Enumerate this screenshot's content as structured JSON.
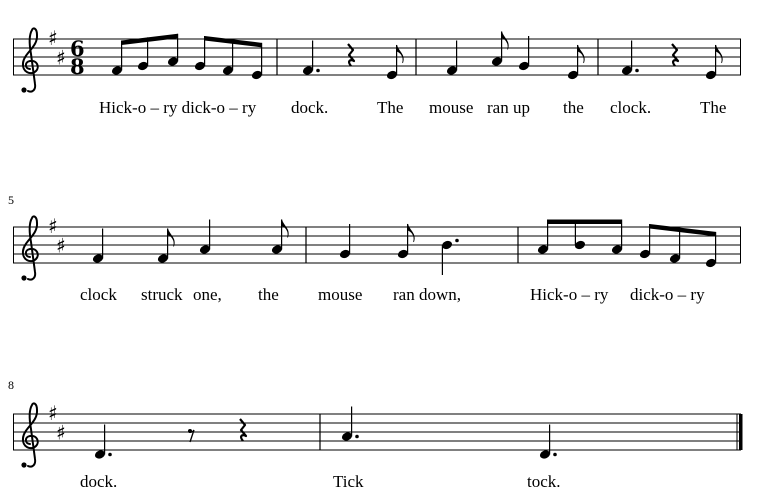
{
  "score": {
    "key_signature": "D major",
    "clef": "treble",
    "time_signature": {
      "top": "6",
      "bottom": "8"
    },
    "systems": [
      {
        "measure_number": "",
        "measures": [
          {
            "notes": [
              {
                "pitch": "F4",
                "duration": "8"
              },
              {
                "pitch": "G4",
                "duration": "8"
              },
              {
                "pitch": "A4",
                "duration": "8"
              },
              {
                "pitch": "G4",
                "duration": "8"
              },
              {
                "pitch": "F4",
                "duration": "8"
              },
              {
                "pitch": "E4",
                "duration": "8"
              }
            ]
          },
          {
            "notes": [
              {
                "pitch": "F4",
                "duration": "4."
              },
              {
                "pitch": "rest",
                "duration": "4"
              },
              {
                "pitch": "E4",
                "duration": "8"
              }
            ]
          },
          {
            "notes": [
              {
                "pitch": "F4",
                "duration": "4"
              },
              {
                "pitch": "A4",
                "duration": "8"
              },
              {
                "pitch": "G4",
                "duration": "4"
              },
              {
                "pitch": "E4",
                "duration": "8"
              }
            ]
          },
          {
            "notes": [
              {
                "pitch": "F4",
                "duration": "4."
              },
              {
                "pitch": "rest",
                "duration": "4"
              },
              {
                "pitch": "E4",
                "duration": "8"
              }
            ]
          }
        ],
        "lyrics": [
          "Hick-o – ry dick-o – ry",
          "dock.",
          "The",
          "mouse",
          "ran up",
          "the",
          "clock.",
          "The"
        ]
      },
      {
        "measure_number": "5",
        "measures": [
          {
            "notes": [
              {
                "pitch": "F4",
                "duration": "4"
              },
              {
                "pitch": "F4",
                "duration": "8"
              },
              {
                "pitch": "A4",
                "duration": "4"
              },
              {
                "pitch": "A4",
                "duration": "8"
              }
            ]
          },
          {
            "notes": [
              {
                "pitch": "G4",
                "duration": "4"
              },
              {
                "pitch": "G4",
                "duration": "8"
              },
              {
                "pitch": "B4",
                "duration": "4."
              }
            ]
          },
          {
            "notes": [
              {
                "pitch": "A4",
                "duration": "8"
              },
              {
                "pitch": "B4",
                "duration": "8"
              },
              {
                "pitch": "A4",
                "duration": "8"
              },
              {
                "pitch": "G4",
                "duration": "8"
              },
              {
                "pitch": "F4",
                "duration": "8"
              },
              {
                "pitch": "E4",
                "duration": "8"
              }
            ]
          }
        ],
        "lyrics": [
          "clock",
          "struck",
          "one,",
          "the",
          "mouse",
          "ran down,",
          "Hick-o – ry",
          "dick-o – ry"
        ]
      },
      {
        "measure_number": "8",
        "measures": [
          {
            "notes": [
              {
                "pitch": "D4",
                "duration": "4."
              },
              {
                "pitch": "rest",
                "duration": "8"
              },
              {
                "pitch": "rest",
                "duration": "4"
              }
            ]
          },
          {
            "notes": [
              {
                "pitch": "A4",
                "duration": "4."
              },
              {
                "pitch": "D4",
                "duration": "4."
              }
            ]
          }
        ],
        "lyrics": [
          "dock.",
          "Tick",
          "tock."
        ]
      }
    ]
  }
}
